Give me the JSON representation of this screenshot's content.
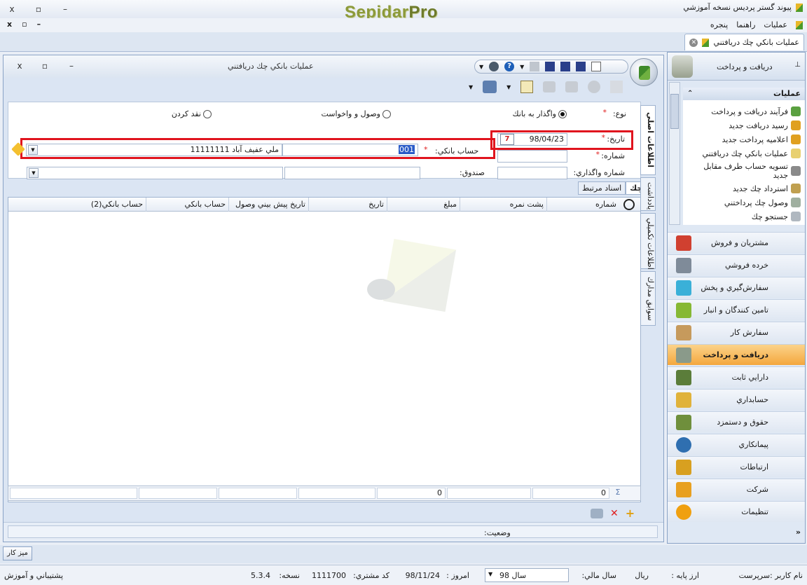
{
  "app": {
    "title": "پيوند گستر پرديس نسخه آموزشي",
    "logo_a": "Sepidar",
    "logo_b": "Pro",
    "window_buttons": [
      "x",
      "▫",
      "–"
    ]
  },
  "menu": {
    "items": [
      "عمليات",
      "راهنما",
      "پنجره"
    ],
    "mdi_buttons": [
      "x",
      "▫",
      "–"
    ]
  },
  "doctab": {
    "label": "عمليات بانكي چك دريافتني"
  },
  "window": {
    "title": "عمليات بانكي چك دريافتني",
    "buttons": [
      "x",
      "▫",
      "–"
    ]
  },
  "form": {
    "type_label": "نوع:",
    "type_options": [
      {
        "label": "واگذار به بانك",
        "selected": true
      },
      {
        "label": "وصول و واخواست",
        "selected": false
      },
      {
        "label": "نقد كردن",
        "selected": false
      }
    ],
    "date_label": "تاريخ:",
    "date_value": "98/04/23",
    "number_label": "شماره:",
    "bank_account_label": "حساب بانكي:",
    "bank_code": "001",
    "bank_name": "ملي عفيف آباد 11111111",
    "assign_number_label": "شماره واگذاري:",
    "cashbox_label": "صندوق:",
    "required_mark": "*"
  },
  "subtabs": [
    "چك",
    "اسناد مرتبط"
  ],
  "vtabs": [
    "اطلاعات اصلي",
    "يادداشت",
    "اطلاعات تكميلي",
    "سوابق مدارك"
  ],
  "grid": {
    "columns": [
      "شماره",
      "پشت نمره",
      "مبلغ",
      "تاريخ",
      "تاريخ پيش بيني وصول",
      "حساب بانكي",
      "حساب بانكي(2)"
    ],
    "footer_count": "0",
    "footer_sum": "0",
    "sigma": "Σ"
  },
  "status": {
    "label": "وضعيت:"
  },
  "right_panel": {
    "title": "دريافت و پرداخت",
    "pin": "📌",
    "section_title": "عمليات",
    "items": [
      "فرآيند دريافت و پرداخت",
      "رسيد دريافت جديد",
      "اعلاميه پرداخت جديد",
      "عمليات بانكي چك دريافتني",
      "تسويه حساب طرف مقابل جديد",
      "استرداد چك جديد",
      "وصول چك پرداختني",
      "جستجو چك"
    ],
    "categories": [
      {
        "label": "مشتريان و فروش",
        "color": "#d04030",
        "active": false
      },
      {
        "label": "خرده فروشي",
        "color": "#7f8b99",
        "active": false
      },
      {
        "label": "سفارش‌گيري و پخش",
        "color": "#3ab0d8",
        "active": false
      },
      {
        "label": "تامين كنندگان و انبار",
        "color": "#86b834",
        "active": false
      },
      {
        "label": "سفارش كار",
        "color": "#c69a5c",
        "active": false
      },
      {
        "label": "دريافت و پرداخت",
        "color": "#8a9a8a",
        "active": true
      },
      {
        "label": "دارايي ثابت",
        "color": "#5b7d3a",
        "active": false
      },
      {
        "label": "حسابداري",
        "color": "#e0b23a",
        "active": false
      },
      {
        "label": "حقوق و دستمزد",
        "color": "#6f8f3c",
        "active": false
      },
      {
        "label": "پيمانكاري",
        "color": "#2f6fb0",
        "active": false
      },
      {
        "label": "ارتباطات",
        "color": "#d8a020",
        "active": false
      },
      {
        "label": "شركت",
        "color": "#e8a020",
        "active": false
      },
      {
        "label": "تنظيمات",
        "color": "#f0a010",
        "active": false
      }
    ],
    "expand": "»"
  },
  "bottom": {
    "desk_button": "ميز كار"
  },
  "statusbar": {
    "username_label": "نام كاربر :سرپرست",
    "base_currency_label": "ارز پايه :",
    "base_currency_value": "ريال",
    "fiscal_year_label": "سال مالي:",
    "fiscal_year_value": "سال 98",
    "today_label": "امروز :",
    "today_value": "98/11/24",
    "customer_code_label": "كد مشتري:",
    "customer_code_value": "1111700",
    "version_label": "نسخه:",
    "version_value": "5.3.4",
    "support": "پشتيباني و آموزش"
  }
}
